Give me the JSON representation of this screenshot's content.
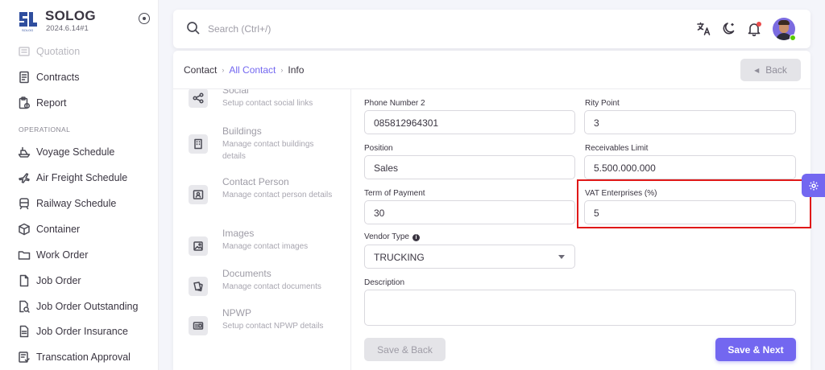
{
  "brand": {
    "name": "SOLOG",
    "version": "2024.6.14#1"
  },
  "sidebar": {
    "items_top": [
      {
        "label": "Quotation",
        "icon": "document-icon"
      },
      {
        "label": "Contracts",
        "icon": "contract-icon"
      },
      {
        "label": "Report",
        "icon": "report-icon"
      }
    ],
    "section_label": "OPERATIONAL",
    "items": [
      {
        "label": "Voyage Schedule",
        "icon": "ship-icon"
      },
      {
        "label": "Air Freight Schedule",
        "icon": "plane-icon"
      },
      {
        "label": "Railway Schedule",
        "icon": "train-icon"
      },
      {
        "label": "Container",
        "icon": "box-icon"
      },
      {
        "label": "Work Order",
        "icon": "folder-icon"
      },
      {
        "label": "Job Order",
        "icon": "file-icon"
      },
      {
        "label": "Job Order Outstanding",
        "icon": "file-search-icon"
      },
      {
        "label": "Job Order Insurance",
        "icon": "file-text-icon"
      },
      {
        "label": "Transcation Approval",
        "icon": "checklist-icon"
      }
    ]
  },
  "header": {
    "search_placeholder": "Search (Ctrl+/)"
  },
  "breadcrumb": {
    "root": "Contact",
    "link": "All Contact",
    "current": "Info"
  },
  "back_label": "Back",
  "subnav": [
    {
      "title": "Social",
      "desc": "Setup contact social links",
      "icon": "share-icon"
    },
    {
      "title": "Buildings",
      "desc": "Manage contact buildings details",
      "icon": "building-icon"
    },
    {
      "title": "Contact Person",
      "desc": "Manage contact person details",
      "icon": "contact-card-icon"
    },
    {
      "title": "Images",
      "desc": "Manage contact images",
      "icon": "image-icon"
    },
    {
      "title": "Documents",
      "desc": "Manage contact documents",
      "icon": "documents-icon"
    },
    {
      "title": "NPWP",
      "desc": "Setup contact NPWP details",
      "icon": "id-card-icon"
    }
  ],
  "form": {
    "phone2": {
      "label": "Phone Number 2",
      "value": "085812964301"
    },
    "rity_point": {
      "label": "Rity Point",
      "value": "3"
    },
    "position": {
      "label": "Position",
      "value": "Sales"
    },
    "receivables_limit": {
      "label": "Receivables Limit",
      "value": "5.500.000.000"
    },
    "term_of_payment": {
      "label": "Term of Payment",
      "value": "30"
    },
    "vat_enterprises": {
      "label": "VAT Enterprises (%)",
      "value": "5"
    },
    "vendor_type": {
      "label": "Vendor Type",
      "value": "TRUCKING"
    },
    "description": {
      "label": "Description",
      "value": ""
    }
  },
  "buttons": {
    "save_back": "Save & Back",
    "save_next": "Save & Next"
  },
  "colors": {
    "primary": "#7367f0",
    "highlight": "#e01818"
  }
}
